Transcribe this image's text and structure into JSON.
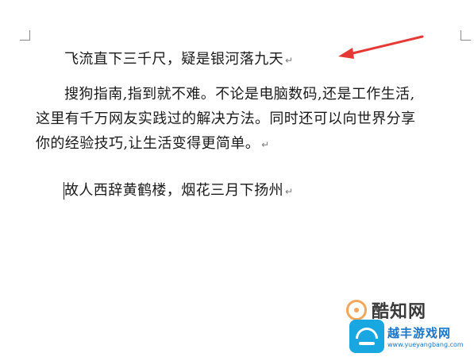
{
  "document": {
    "line1": "飞流直下三千尺，疑是银河落九天",
    "para2_line1": "搜狗指南,指到就不难。不论是电脑数码,还是工作生活,",
    "para2_line2": "这里有千万网友实践过的解决方法。同时还可以向世界分享",
    "para2_line3": "你的经验技巧,让生活变得更简单。",
    "line5": "故人西辞黄鹤楼，烟花三月下扬州",
    "paragraph_mark": "↵"
  },
  "watermarks": {
    "brand1": "酷知网",
    "brand2": "越丰游戏网",
    "brand2_url": "www.yueyangbang.com"
  },
  "colors": {
    "arrow": "#e53935",
    "brand1_accent": "#f2a65a",
    "brand2_accent": "#18a7e0"
  }
}
